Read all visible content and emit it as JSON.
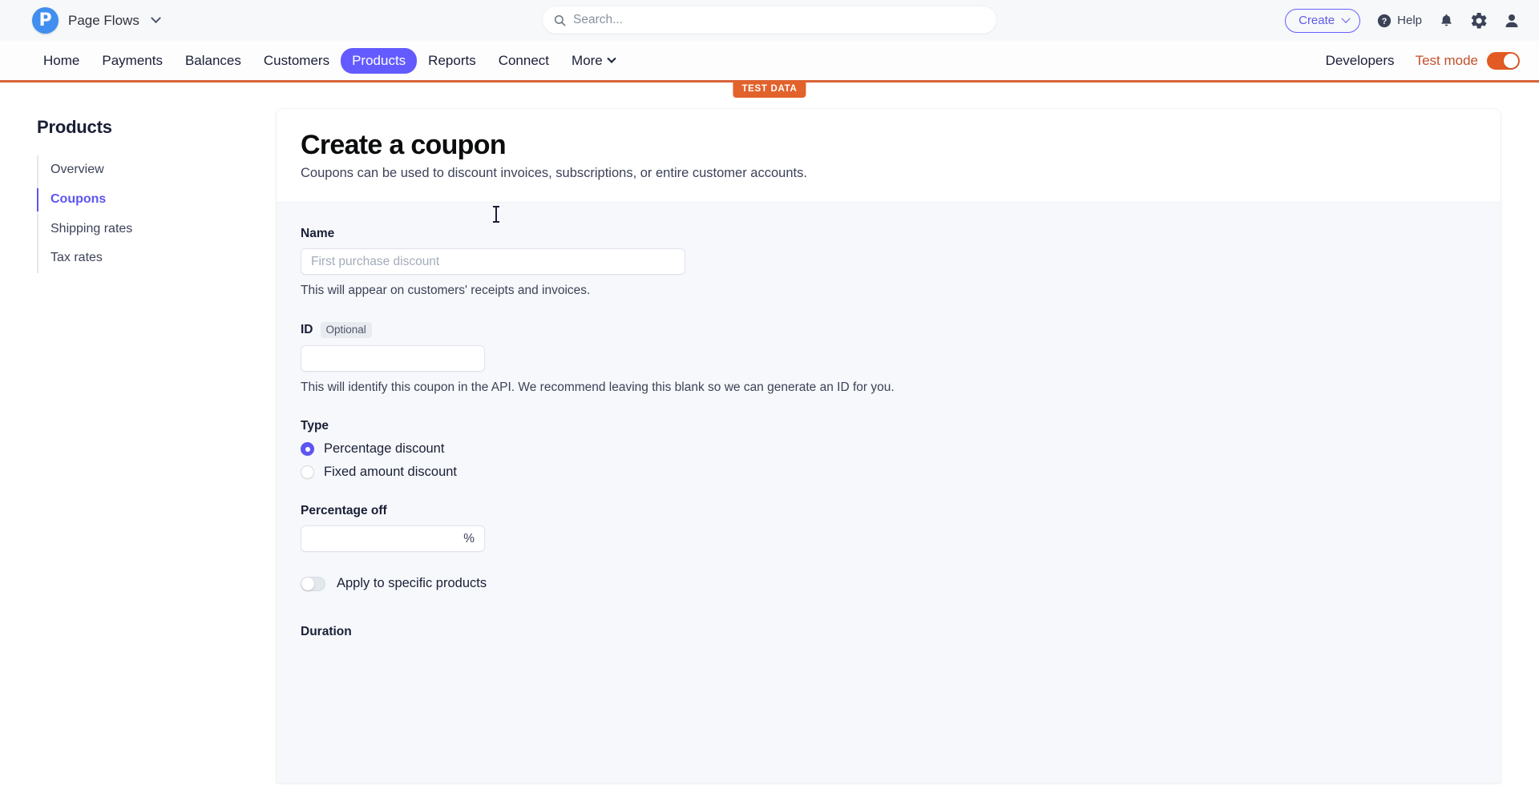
{
  "topbar": {
    "brand_name": "Page Flows",
    "brand_initial": "P",
    "search_placeholder": "Search...",
    "create_label": "Create",
    "help_label": "Help",
    "icons": {
      "search": "search-icon",
      "help": "help-circle-icon",
      "notifications": "bell-icon",
      "settings": "gear-icon",
      "account": "user-icon",
      "brand_chevron": "chevron-down-icon",
      "create_chevron": "chevron-down-icon"
    }
  },
  "nav": {
    "items": [
      {
        "label": "Home",
        "active": false,
        "has_chevron": false
      },
      {
        "label": "Payments",
        "active": false,
        "has_chevron": false
      },
      {
        "label": "Balances",
        "active": false,
        "has_chevron": false
      },
      {
        "label": "Customers",
        "active": false,
        "has_chevron": false
      },
      {
        "label": "Products",
        "active": true,
        "has_chevron": false
      },
      {
        "label": "Reports",
        "active": false,
        "has_chevron": false
      },
      {
        "label": "Connect",
        "active": false,
        "has_chevron": false
      },
      {
        "label": "More",
        "active": false,
        "has_chevron": true
      }
    ],
    "developers_label": "Developers",
    "test_mode_label": "Test mode",
    "test_mode_on": true,
    "test_data_badge": "TEST DATA",
    "accent_active": "#635bff",
    "accent_test": "#e25b24"
  },
  "sidebar": {
    "title": "Products",
    "items": [
      {
        "label": "Overview",
        "active": false
      },
      {
        "label": "Coupons",
        "active": true
      },
      {
        "label": "Shipping rates",
        "active": false
      },
      {
        "label": "Tax rates",
        "active": false
      }
    ],
    "active_color": "#5d55f0"
  },
  "main": {
    "title": "Create a coupon",
    "subtitle": "Coupons can be used to discount invoices, subscriptions, or entire customer accounts.",
    "name_field": {
      "label": "Name",
      "value": "",
      "placeholder": "First purchase discount",
      "help": "This will appear on customers' receipts and invoices."
    },
    "id_field": {
      "label": "ID",
      "optional_badge": "Optional",
      "value": "",
      "placeholder": "",
      "help": "This will identify this coupon in the API. We recommend leaving this blank so we can generate an ID for you."
    },
    "type_field": {
      "label": "Type",
      "options": [
        {
          "label": "Percentage discount",
          "selected": true
        },
        {
          "label": "Fixed amount discount",
          "selected": false
        }
      ]
    },
    "percentage_field": {
      "label": "Percentage off",
      "value": "",
      "placeholder": "",
      "suffix": "%"
    },
    "apply_products_toggle": {
      "label": "Apply to specific products",
      "on": false
    },
    "duration_label": "Duration"
  }
}
